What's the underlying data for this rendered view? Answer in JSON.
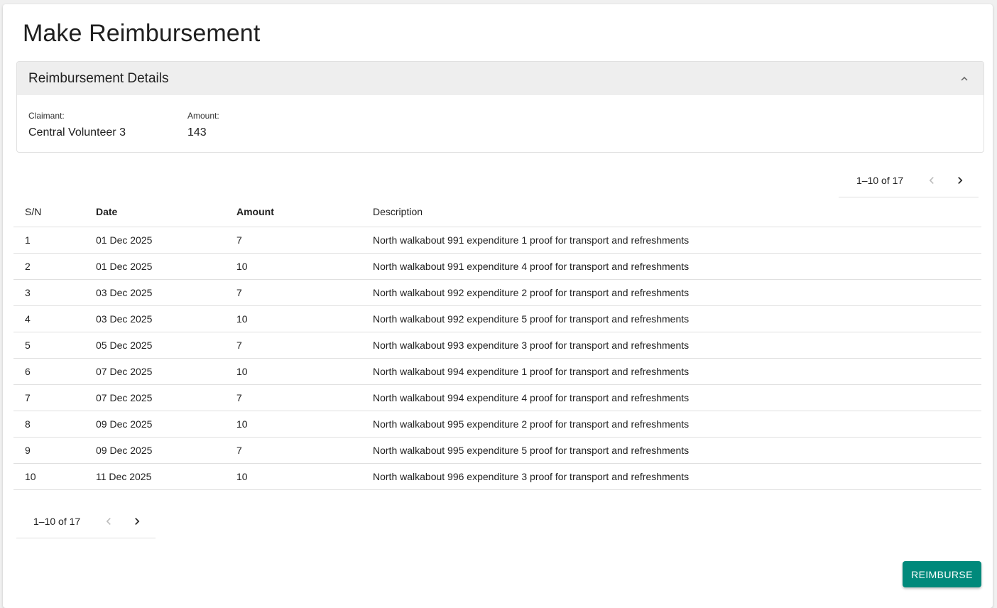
{
  "page": {
    "title": "Make Reimbursement"
  },
  "details": {
    "title": "Reimbursement Details",
    "claimant_label": "Claimant:",
    "claimant_value": "Central Volunteer 3",
    "amount_label": "Amount:",
    "amount_value": "143"
  },
  "pagination": {
    "range": "1–10 of 17"
  },
  "table": {
    "headers": [
      "S/N",
      "Date",
      "Amount",
      "Description"
    ],
    "rows": [
      [
        "1",
        "01 Dec 2025",
        "7",
        "North walkabout 991 expenditure 1 proof for transport and refreshments"
      ],
      [
        "2",
        "01 Dec 2025",
        "10",
        "North walkabout 991 expenditure 4 proof for transport and refreshments"
      ],
      [
        "3",
        "03 Dec 2025",
        "7",
        "North walkabout 992 expenditure 2 proof for transport and refreshments"
      ],
      [
        "4",
        "03 Dec 2025",
        "10",
        "North walkabout 992 expenditure 5 proof for transport and refreshments"
      ],
      [
        "5",
        "05 Dec 2025",
        "7",
        "North walkabout 993 expenditure 3 proof for transport and refreshments"
      ],
      [
        "6",
        "07 Dec 2025",
        "10",
        "North walkabout 994 expenditure 1 proof for transport and refreshments"
      ],
      [
        "7",
        "07 Dec 2025",
        "7",
        "North walkabout 994 expenditure 4 proof for transport and refreshments"
      ],
      [
        "8",
        "09 Dec 2025",
        "10",
        "North walkabout 995 expenditure 2 proof for transport and refreshments"
      ],
      [
        "9",
        "09 Dec 2025",
        "7",
        "North walkabout 995 expenditure 5 proof for transport and refreshments"
      ],
      [
        "10",
        "11 Dec 2025",
        "10",
        "North walkabout 996 expenditure 3 proof for transport and refreshments"
      ]
    ]
  },
  "actions": {
    "reimburse_label": "REIMBURSE"
  },
  "icons": {
    "collapse": "chevron-up-icon",
    "prev": "chevron-left-icon",
    "next": "chevron-right-icon"
  },
  "colors": {
    "primary": "#00897b",
    "panel_header": "#eeeeee",
    "disabled_icon": "#bdbdbd"
  }
}
